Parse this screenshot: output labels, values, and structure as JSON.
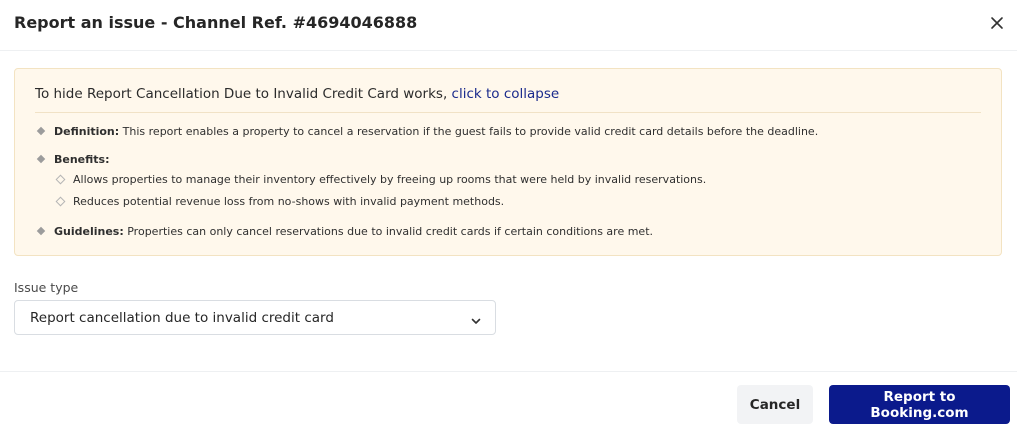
{
  "dialog": {
    "title": "Report an issue - Channel Ref. #4694046888",
    "close_icon": "close-icon"
  },
  "info": {
    "intro_text": "To hide Report Cancellation Due to Invalid Credit Card works, ",
    "collapse_link": "click to collapse",
    "definition_label": "Definition:",
    "definition_text": " This report enables a property to cancel a reservation if the guest fails to provide valid credit card details before the deadline.",
    "benefits_label": "Benefits:",
    "benefits": [
      "Allows properties to manage their inventory effectively by freeing up rooms that were held by invalid reservations.",
      "Reduces potential revenue loss from no-shows with invalid payment methods."
    ],
    "guidelines_label": "Guidelines:",
    "guidelines_text": " Properties can only cancel reservations due to invalid credit cards if certain conditions are met."
  },
  "form": {
    "issue_type_label": "Issue type",
    "issue_type_value": "Report cancellation due to invalid credit card",
    "chevron_icon": "chevron-down-icon"
  },
  "footer": {
    "cancel_label": "Cancel",
    "submit_label": "Report to Booking.com"
  },
  "colors": {
    "primary": "#0b1a8c",
    "info_background": "#fff8ec",
    "link": "#1a2a8c"
  }
}
